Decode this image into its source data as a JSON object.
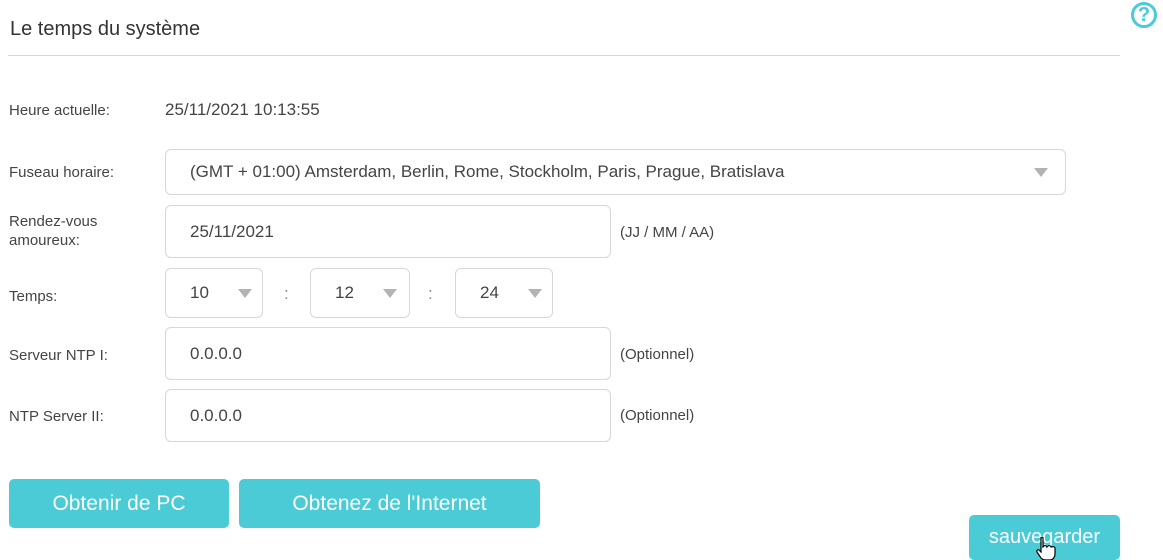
{
  "header": {
    "title": "Le temps du système",
    "help_icon": "?"
  },
  "current_time": {
    "label": "Heure actuelle:",
    "value": "25/11/2021 10:13:55"
  },
  "timezone": {
    "label": "Fuseau horaire:",
    "selected": "(GMT + 01:00) Amsterdam, Berlin, Rome, Stockholm, Paris, Prague, Bratislava"
  },
  "date": {
    "label_line1": "Rendez-vous",
    "label_line2": "amoureux:",
    "value": "25/11/2021",
    "hint": "(JJ / MM / AA)"
  },
  "time": {
    "label": "Temps:",
    "hour": "10",
    "minute": "12",
    "second": "24",
    "separator": ":"
  },
  "ntp1": {
    "label": "Serveur NTP I:",
    "value": "0.0.0.0",
    "hint": "(Optionnel)"
  },
  "ntp2": {
    "label": "NTP Server II:",
    "value": "0.0.0.0",
    "hint": "(Optionnel)"
  },
  "buttons": {
    "from_pc": "Obtenir de PC",
    "from_internet": "Obtenez de l'Internet",
    "save": "sauvegarder"
  },
  "colors": {
    "accent": "#4acbd6",
    "border": "#d7d7d7",
    "text": "#444444"
  },
  "icons": {
    "help": "help-circle-icon",
    "dropdown": "caret-down-icon",
    "cursor": "hand-pointer-icon"
  }
}
